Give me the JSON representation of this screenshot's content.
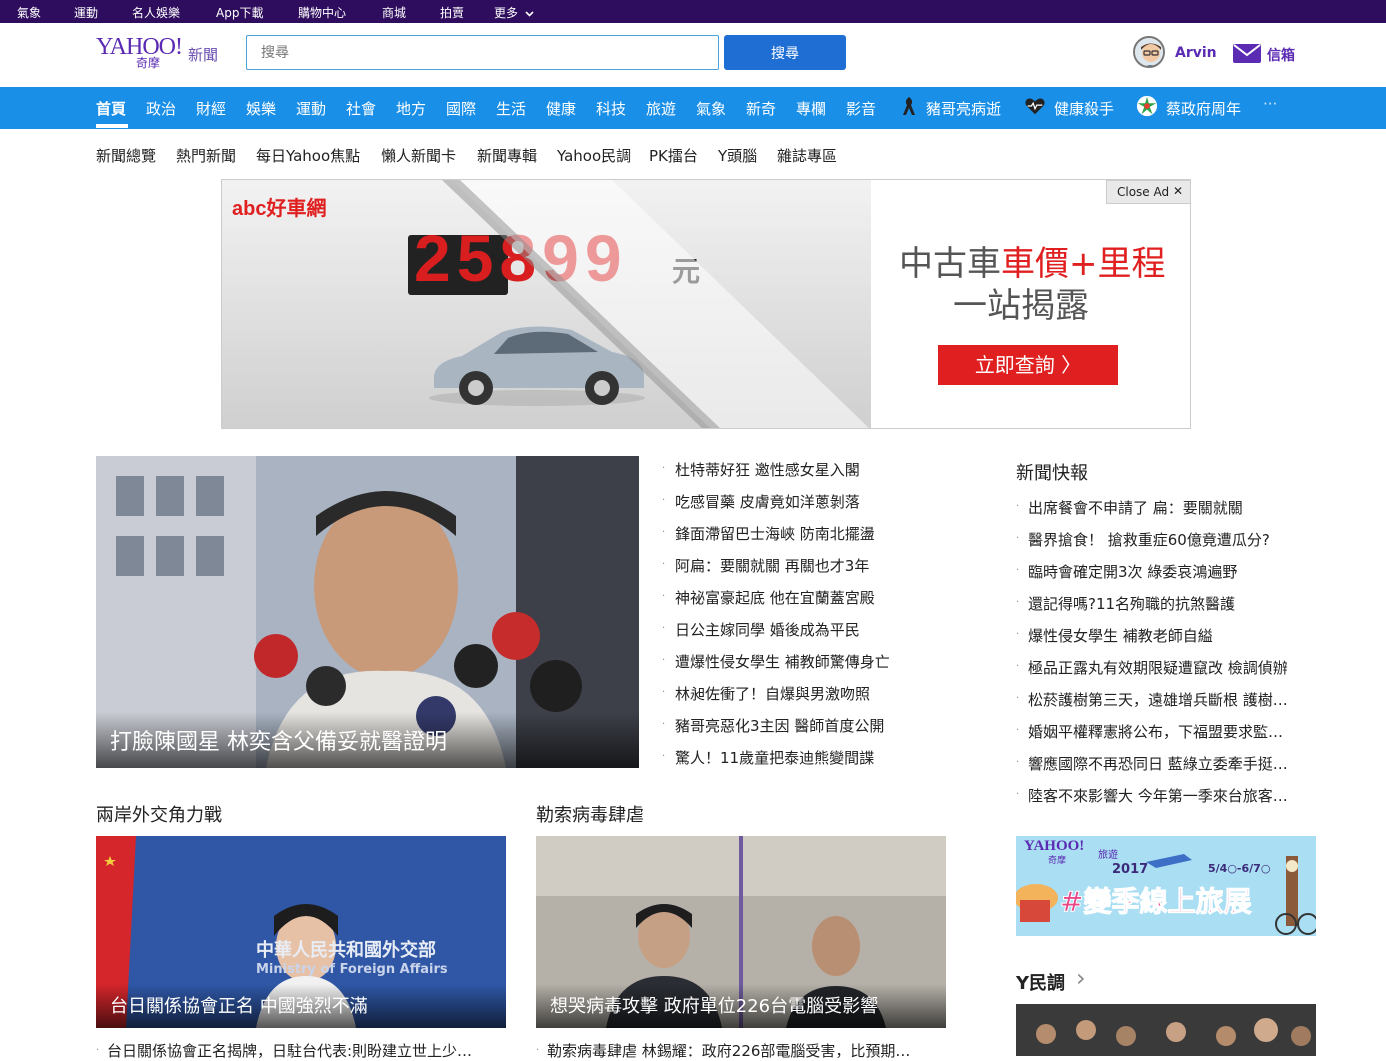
{
  "topbar": {
    "links": [
      "氣象",
      "運動",
      "名人娛樂",
      "App下載",
      "購物中心",
      "商城",
      "拍賣",
      "更多"
    ]
  },
  "header": {
    "logo_text": "YAHOO!",
    "logo_sub": "奇摩",
    "section": "新聞",
    "search_placeholder": "搜尋",
    "search_button": "搜尋",
    "user_name": "Arvin",
    "mail_label": "信箱"
  },
  "nav": {
    "items": [
      "首頁",
      "政治",
      "財經",
      "娛樂",
      "運動",
      "社會",
      "地方",
      "國際",
      "生活",
      "健康",
      "科技",
      "旅遊",
      "氣象",
      "新奇",
      "專欄",
      "影音"
    ],
    "specials": [
      "豬哥亮病逝",
      "健康殺手",
      "蔡政府周年"
    ],
    "more": "···"
  },
  "subnav": [
    "新聞總覽",
    "熱門新聞",
    "每日Yahoo焦點",
    "懶人新聞卡",
    "新聞專輯",
    "Yahoo民調",
    "PK擂台",
    "Y頭腦",
    "雜誌專區"
  ],
  "ad": {
    "brand": "abc好車網",
    "price": "25899",
    "price_unit": "元",
    "headline_a": "中古車",
    "headline_b": "車價+里程",
    "headline_2": "一站揭露",
    "cta": "立即查詢 〉",
    "close_label": "Close Ad",
    "close_x": "✕"
  },
  "hero": {
    "caption": "打臉陳國星 林奕含父備妥就醫證明"
  },
  "headlines": [
    "杜特蒂好狂 邀性感女星入閣",
    "吃感冒藥 皮膚竟如洋蔥剝落",
    "鋒面滯留巴士海峽 防南北擺盪",
    "阿扁：要關就關 再關也才3年",
    "神祕富豪起底 他在宜蘭蓋宮殿",
    "日公主嫁同學 婚後成為平民",
    "遭爆性侵女學生 補教師驚傳身亡",
    "林昶佐衝了！自爆與男激吻照",
    "豬哥亮惡化3主因 醫師首度公開",
    "驚人！11歲童把泰迪熊變間諜"
  ],
  "flash": {
    "title": "新聞快報",
    "items": [
      "出席餐會不申請了 扁：要關就關",
      "醫界搶食！ 搶救重症60億竟遭瓜分?",
      "臨時會確定開3次 綠委哀鴻遍野",
      "還記得嗎?11名殉職的抗煞醫護",
      "爆性侵女學生 補教老師自縊",
      "極品正露丸有效期限疑遭竄改 檢調偵辦",
      "松菸護樹第三天，遠雄增兵斷根 護樹…",
      "婚姻平權釋憲將公布，下福盟要求監…",
      "響應國際不再恐同日 藍綠立委牽手挺…",
      "陸客不來影響大 今年第一季來台旅客…"
    ]
  },
  "section1": {
    "title": "兩岸外交角力戰",
    "caption": "台日關係協會正名 中國強烈不滿",
    "img_sign": "中華人民共和國外交部",
    "img_sign_en": "Ministry of Foreign Affairs",
    "bottom": "台日關係協會正名揭牌，日駐台代表:則盼建立世上少…"
  },
  "section2": {
    "title": "勒索病毒肆虐",
    "caption": "想哭病毒攻擊 政府單位226台電腦受影響",
    "bottom": "勒索病毒肆虐 林錫耀：政府226部電腦受害，比預期…"
  },
  "travel_ad": {
    "brand": "YAHOO!",
    "brand_sub": "奇摩",
    "tag": "旅遊",
    "year": "2017",
    "dates": "5/4○-6/7○",
    "title": "#變季線上旅展"
  },
  "poll": {
    "title": "Y民調",
    "arrow": "›"
  },
  "colors": {
    "topbar": "#2e0d5e",
    "brand_purple": "#5b2bb3",
    "nav_blue": "#1a8fe8",
    "search_button": "#1f6ed4",
    "ad_red": "#e02020"
  }
}
